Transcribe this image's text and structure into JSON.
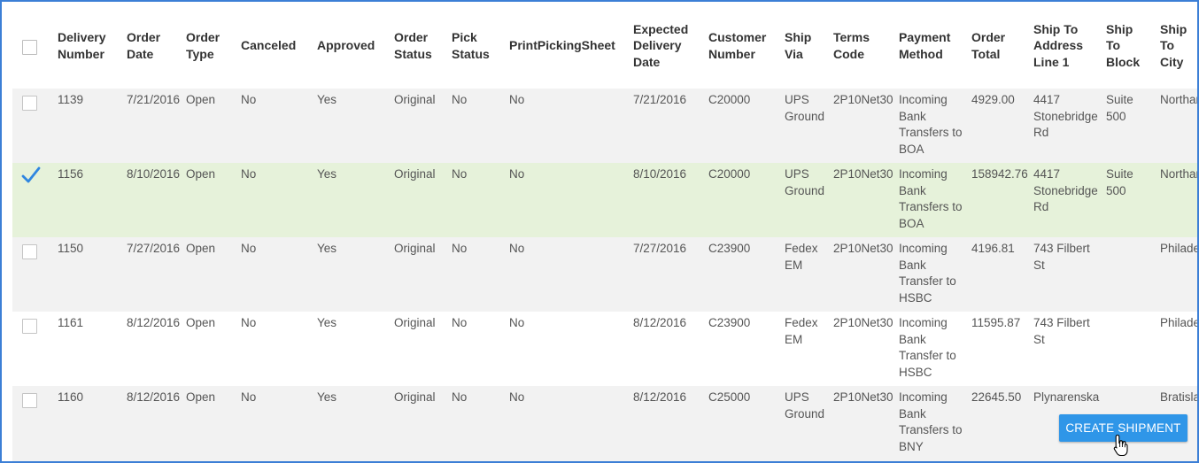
{
  "columns": [
    {
      "key": "delivery_number",
      "label": "Delivery\nNumber"
    },
    {
      "key": "order_date",
      "label": "Order\nDate"
    },
    {
      "key": "order_type",
      "label": "Order\nType"
    },
    {
      "key": "canceled",
      "label": "Canceled"
    },
    {
      "key": "approved",
      "label": "Approved"
    },
    {
      "key": "order_status",
      "label": "Order\nStatus"
    },
    {
      "key": "pick_status",
      "label": "Pick\nStatus"
    },
    {
      "key": "print_picking_sheet",
      "label": "PrintPickingSheet"
    },
    {
      "key": "expected_delivery_date",
      "label": "Expected\nDelivery\nDate"
    },
    {
      "key": "customer_number",
      "label": "Customer\nNumber"
    },
    {
      "key": "ship_via",
      "label": "Ship\nVia"
    },
    {
      "key": "terms_code",
      "label": "Terms\nCode"
    },
    {
      "key": "payment_method",
      "label": "Payment\nMethod"
    },
    {
      "key": "order_total",
      "label": "Order\nTotal"
    },
    {
      "key": "ship_to_address_line1",
      "label": "Ship To\nAddress\nLine 1"
    },
    {
      "key": "ship_to_block",
      "label": "Ship\nTo\nBlock"
    },
    {
      "key": "ship_to_city",
      "label": "Ship To\nCity"
    }
  ],
  "rows": [
    {
      "selected": false,
      "cells": [
        "1139",
        "7/21/2016",
        "Open",
        "No",
        "Yes",
        "Original",
        "No",
        "No",
        "7/21/2016",
        "C20000",
        "UPS\nGround",
        "2P10Net30",
        "Incoming\nBank\nTransfers to\nBOA",
        "4929.00",
        "4417\nStonebridge\nRd",
        "Suite\n500",
        "Northampton"
      ]
    },
    {
      "selected": true,
      "cells": [
        "1156",
        "8/10/2016",
        "Open",
        "No",
        "Yes",
        "Original",
        "No",
        "No",
        "8/10/2016",
        "C20000",
        "UPS\nGround",
        "2P10Net30",
        "Incoming\nBank\nTransfers to\nBOA",
        "158942.76",
        "4417\nStonebridge\nRd",
        "Suite\n500",
        "Northampton"
      ]
    },
    {
      "selected": false,
      "cells": [
        "1150",
        "7/27/2016",
        "Open",
        "No",
        "Yes",
        "Original",
        "No",
        "No",
        "7/27/2016",
        "C23900",
        "Fedex\nEM",
        "2P10Net30",
        "Incoming\nBank\nTransfer to\nHSBC",
        "4196.81",
        "743 Filbert\nSt",
        "",
        "Philadelphia"
      ]
    },
    {
      "selected": false,
      "cells": [
        "1161",
        "8/12/2016",
        "Open",
        "No",
        "Yes",
        "Original",
        "No",
        "No",
        "8/12/2016",
        "C23900",
        "Fedex\nEM",
        "2P10Net30",
        "Incoming\nBank\nTransfer to\nHSBC",
        "11595.87",
        "743 Filbert\nSt",
        "",
        "Philadelphia"
      ]
    },
    {
      "selected": false,
      "cells": [
        "1160",
        "8/12/2016",
        "Open",
        "No",
        "Yes",
        "Original",
        "No",
        "No",
        "8/12/2016",
        "C25000",
        "UPS\nGround",
        "2P10Net30",
        "Incoming\nBank\nTransfers to\nBNY",
        "22645.50",
        "Plynarenska",
        "",
        "Bratislava"
      ]
    }
  ],
  "actions": {
    "create_shipment_label": "CREATE SHIPMENT"
  },
  "icons": {
    "row_check": "checkmark-icon",
    "pointer": "hand-pointer-icon"
  },
  "colors": {
    "frame_border": "#3c7fd6",
    "selected_row": "#e6f2da",
    "alt_row": "#f2f2f2",
    "checkmark": "#2f86e0",
    "button": "#2f96e8"
  }
}
